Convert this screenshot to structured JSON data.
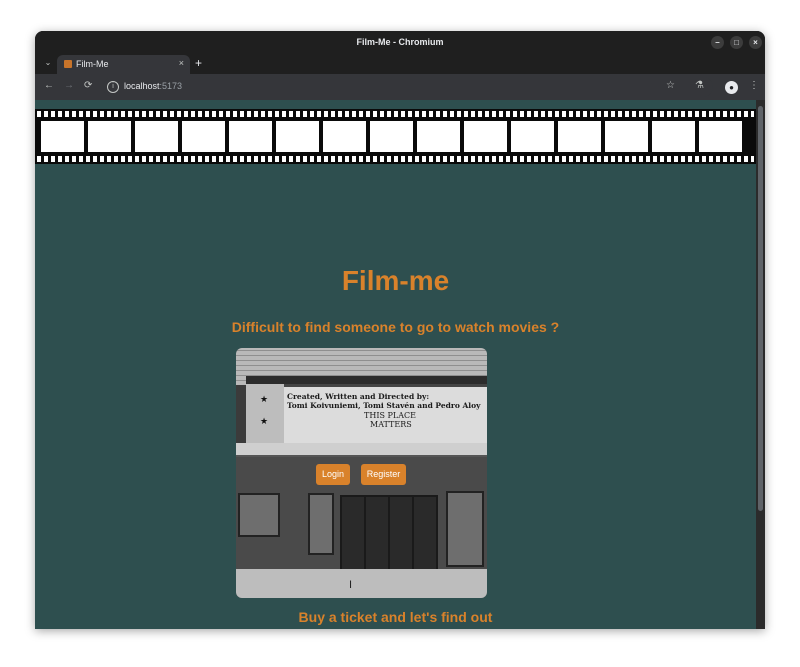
{
  "window": {
    "title": "Film-Me - Chromium"
  },
  "tabs": [
    {
      "title": "Film-Me",
      "close": "×"
    }
  ],
  "new_tab": "+",
  "address": {
    "host": "localhost",
    "port": ":5173"
  },
  "page": {
    "heading": "Film-me",
    "subtitle": "Difficult to find someone to go to watch movies ?",
    "footer_text": "Buy a ticket and let's find out",
    "buttons": {
      "login": "Login",
      "register": "Register"
    },
    "marquee": {
      "line1": "Created, Written and Directed by:",
      "line2": "Tomi Koivuniemi, Tomi Stavén and Pedro Aloy",
      "line3": "THIS PLACE",
      "line4": "MATTERS"
    }
  },
  "colors": {
    "page_bg": "#2e4f4f",
    "accent": "#d9822b"
  },
  "icons": {
    "back": "←",
    "forward": "→",
    "reload": "⟳",
    "star": "☆",
    "labs": "⚗",
    "menu": "⋮",
    "tab_dropdown": "⌄",
    "minimize": "–",
    "maximize": "□",
    "close": "×",
    "profile": "●"
  }
}
